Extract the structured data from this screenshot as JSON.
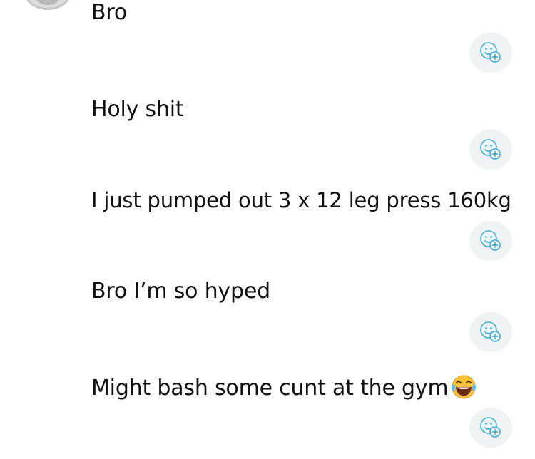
{
  "messages": [
    {
      "text": "Bro"
    },
    {
      "text": "Holy shit"
    },
    {
      "text": "I just pumped out 3 x 12 leg press 160kg"
    },
    {
      "text": "Bro I’m so hyped"
    },
    {
      "text": "Might bash some cunt at the gym"
    }
  ],
  "icons": {
    "add_reaction": "add-reaction-icon",
    "emoji": "face-with-tears-of-joy"
  },
  "colors": {
    "text": "#111111",
    "reaction_bg": "#f1f2f3",
    "reaction_icon": "#3ab0d8"
  }
}
